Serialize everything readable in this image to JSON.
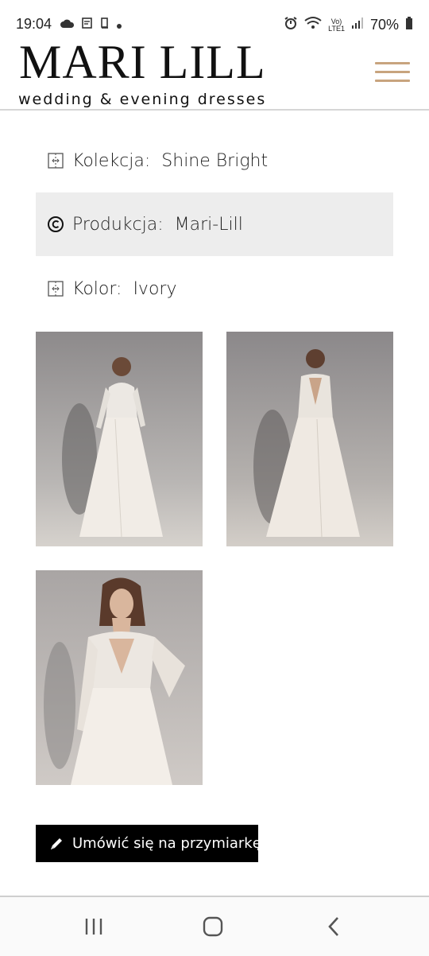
{
  "status_bar": {
    "time": "19:04",
    "battery": "70%",
    "network": "LTE1"
  },
  "header": {
    "logo": "MARI LILL",
    "tagline": "wedding & evening dresses",
    "menu_icon": "hamburger-menu-icon",
    "accent_color": "#c8a47e"
  },
  "attributes": [
    {
      "label": "Kolekcja:",
      "value": "Shine Bright",
      "icon": "split-square-icon"
    },
    {
      "label": "Produkcja:",
      "value": "Mari-Lill",
      "icon": "copyright-icon"
    },
    {
      "label": "Kolor:",
      "value": "Ivory",
      "icon": "split-square-icon"
    }
  ],
  "gallery": [
    {
      "name": "dress-front-view"
    },
    {
      "name": "dress-back-view"
    },
    {
      "name": "dress-closeup-view"
    }
  ],
  "cta": {
    "label": "Umówić się na przymiarkę",
    "icon": "pen-icon"
  },
  "nav_bar": {
    "buttons": [
      "recent-apps-icon",
      "home-icon",
      "back-icon"
    ]
  }
}
